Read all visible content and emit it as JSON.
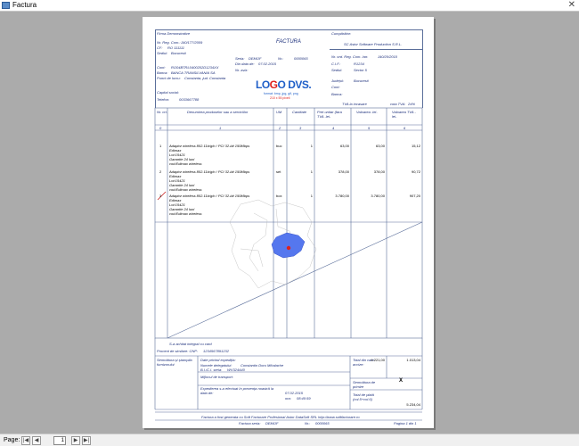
{
  "window": {
    "title": "Factura"
  },
  "supplier": {
    "name": "Firma Demonstrative",
    "reg_label": "Nr. Reg. Com.:",
    "reg_value": "J40/177/2009",
    "cif_label": "CF:",
    "cif_value": "RO 111111",
    "seat_label": "Sediul:",
    "seat_value": "Bucuresti",
    "account_label": "Cont:",
    "account_value": "RO04BTRL0400202D1234XX",
    "bank_label": "Banca:",
    "bank_value": "BANCA TRANSILVANIA SA",
    "point_label": "Punct de lucru:",
    "point_value": "Constanta, jud. Constanta",
    "capital_label": "Capital social:",
    "phone_label": "Telefon:",
    "phone_value": "0033667788"
  },
  "invoice": {
    "title": "FACTURA",
    "series_label": "Seria:",
    "series_value": "DEMOF",
    "nr_label": "Nr.:",
    "nr_value": "0000065",
    "date_label": "Din data de:",
    "date_value": "07.02.2015",
    "aviz_label": "Nr. aviz:"
  },
  "logo": {
    "text_lo": "LO",
    "text_go": "G",
    "text_o": "O",
    "text_dvs": " DVS.",
    "formats": "format: bmp, jpg, gif, png",
    "size": "210 x 55 pixeli"
  },
  "buyer": {
    "label": "Cumpărător:",
    "name": "SC Astor Software Production S.R.L.",
    "reg_label": "Nr. ord. Reg. Com. /an:",
    "reg_value": "J40/20/2010",
    "cif_label": "C.I.F.:",
    "cif_value": "R1234",
    "seat_label": "Sediul:",
    "seat_value": "Sector 5",
    "county_label": "Județul:",
    "county_value": "Bucuresti",
    "account_label": "Cont:",
    "bank_label": "Banca:"
  },
  "vat": {
    "label": "TVA la incasare",
    "rate_label": "cota TVA:",
    "rate_value": "24%"
  },
  "table": {
    "headers": [
      "Nr. crt.",
      "Denumirea produselor sau a serviciilor",
      "UM",
      "Cantitate",
      "Pret unitar (fara TVA -lei-",
      "Valoarea -lei-",
      "Valoarea TVA -lei-"
    ],
    "index_row": [
      "0",
      "1",
      "2",
      "3",
      "4",
      "5",
      "6"
    ],
    "rows": [
      {
        "nr": "1",
        "lines": [
          "Adaptor wireless 802.11b/g/n / PCI 32-bit 150Mbps",
          "Edimax",
          "Lot:15421",
          "Garantie 24 luni",
          "cod:Edimax wireless"
        ],
        "um": "buc",
        "qty": "1",
        "price": "63,00",
        "value": "63,00",
        "vat": "15,12"
      },
      {
        "nr": "2",
        "lines": [
          "Adaptor wireless 802.11b/g/n / PCI 32-bit 150Mbps",
          "Edimax",
          "Lot:15421",
          "Garantie 24 luni",
          "cod:Edimax wireless"
        ],
        "um": "set",
        "qty": "1",
        "price": "378,00",
        "value": "378,00",
        "vat": "90,72"
      },
      {
        "nr": "3",
        "lines": [
          "Adaptor wireless 802.11b/g/n / PCI 32-bit 150Mbps",
          "Edimax",
          "Lot:15421",
          "Garantie 24 luni",
          "cod:Edimax wireless"
        ],
        "um": "box",
        "qty": "1",
        "price": "3.780,00",
        "value": "3.780,00",
        "vat": "907,20"
      }
    ]
  },
  "footer_notes": {
    "paid": "S-a achitat integral cu card",
    "fiscal_label": "Procent de similare: CNP:",
    "fiscal_value": "1234567891232"
  },
  "bottom": {
    "sign_label": "Semnătura și ștampila furnizorului",
    "delegate_title": "Date privind expediția:",
    "delegate_name_label": "Numele delegatului:",
    "delegate_name_value": "Constantin Doru Mihalache",
    "id_label": "B.I./C.I. seria:",
    "id_value": "WV324440",
    "transport_label": "Mijlocul de transport:",
    "expedition_label": "Expedierea s-a efectuat în prezența noastră la data de:",
    "expedition_date": "07.02.2015",
    "hour_label": "ora:",
    "hour_value": "08:40:59",
    "total_label": "Total din care accize:",
    "total_value": "4.221,00",
    "total_vat": "1.013,04",
    "sign2_label": "Semnătura de primire",
    "x_mark": "X",
    "pay_label": "Total de plată (col.5+col.6)",
    "pay_value": "5.234,04"
  },
  "page_footer": {
    "generated": "Factura a fost generata cu Soft Facturare Profesional Astor DataSoft SRL http://www.softfacturare.ro",
    "series_label": "Factura seria:",
    "series_value": "DEMOF",
    "nr_label": "Nr.:",
    "nr_value": "0000065",
    "page_label": "Pagina 1 din 1"
  },
  "status": {
    "page_label": "Page:",
    "page_value": "1"
  },
  "colors": {
    "accent": "#1a2d7a",
    "logo_blue": "#1f5fc8",
    "logo_red": "#e0201c",
    "romania": "#5577ee"
  }
}
